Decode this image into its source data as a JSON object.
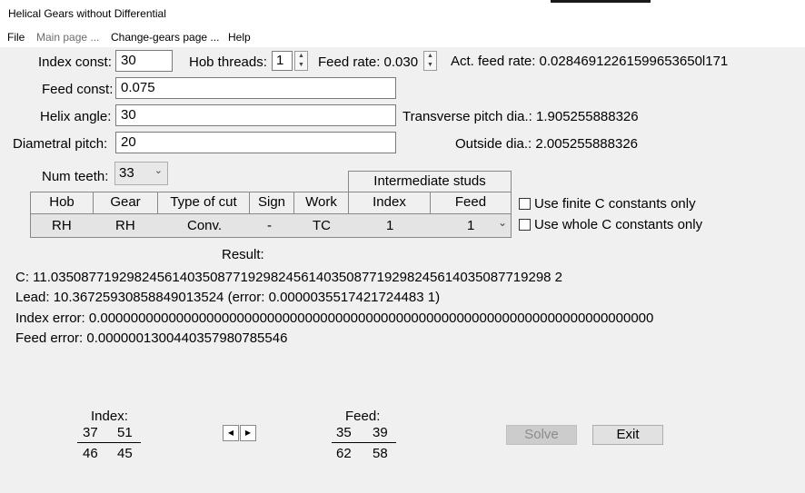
{
  "window": {
    "title": "Helical Gears without Differential"
  },
  "menu": {
    "file": "File",
    "main_page": "Main page ...",
    "change_gears_page": "Change-gears page ...",
    "help": "Help"
  },
  "inputs": {
    "index_const": {
      "label": "Index const:",
      "value": "30"
    },
    "hob_threads": {
      "label": "Hob threads:",
      "value": "1"
    },
    "feed_rate": {
      "label": "Feed rate: 0.030"
    },
    "act_feed_rate": {
      "text": "Act. feed rate: 0.02846912261599653650l171"
    },
    "feed_const": {
      "label": "Feed const:",
      "value": "0.075"
    },
    "helix_angle": {
      "label": "Helix angle:",
      "value": "30"
    },
    "transverse_pitch": {
      "text": "Transverse pitch dia.: 1.905255888326"
    },
    "diametral_pitch": {
      "label": "Diametral pitch:",
      "value": "20"
    },
    "outside_dia": {
      "text": "Outside dia.: 2.005255888326"
    },
    "num_teeth": {
      "label": "Num teeth:",
      "value": "33"
    }
  },
  "table": {
    "group_header": "Intermediate studs",
    "headers": [
      "Hob",
      "Gear",
      "Type of cut",
      "Sign",
      "Work",
      "Index",
      "Feed"
    ],
    "row": [
      "RH",
      "RH",
      "Conv.",
      "-",
      "TC",
      "1",
      "1"
    ]
  },
  "options": {
    "finite_c": "Use finite C constants only",
    "whole_c": "Use whole C constants only"
  },
  "result": {
    "heading": "Result:",
    "c": "C: 11.035087719298245614035087719298245614035087719298245614035087719298 2",
    "lead": "Lead: 10.36725930858849013524 (error: 0.0000035517421724483 1)",
    "index_error": "Index error: 0.0000000000000000000000000000000000000000000000000000000000000000000000000",
    "feed_error": "Feed error: 0.0000001300440357980785546"
  },
  "index_gears": {
    "label": "Index:",
    "top": [
      "37",
      "51"
    ],
    "bottom": [
      "46",
      "45"
    ]
  },
  "feed_gears": {
    "label": "Feed:",
    "top": [
      "35",
      "39"
    ],
    "bottom": [
      "62",
      "58"
    ]
  },
  "buttons": {
    "solve": "Solve",
    "exit": "Exit"
  }
}
